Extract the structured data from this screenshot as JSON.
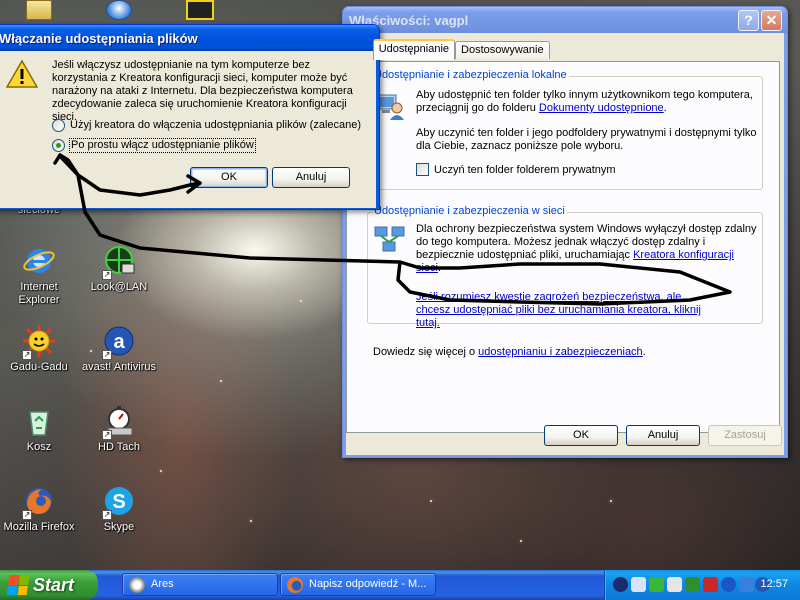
{
  "desktop": {
    "icons": [
      {
        "label": "sieciowe"
      },
      {
        "label": "Internet\nExplorer"
      },
      {
        "label": "Look@LAN"
      },
      {
        "label": "Gadu-Gadu"
      },
      {
        "label": "avast! Antivirus"
      },
      {
        "label": "Kosz"
      },
      {
        "label": "HD Tach"
      },
      {
        "label": "Mozilla Firefox"
      },
      {
        "label": "Skype"
      }
    ]
  },
  "warning_dialog": {
    "title": "Włączanie udostępniania plików",
    "message": "Jeśli włączysz udostępnianie na tym komputerze bez korzystania z Kreatora konfiguracji sieci, komputer może być narażony na ataki z Internetu. Dla bezpieczeństwa komputera zdecydowanie zaleca się uruchomienie Kreatora konfiguracji sieci.",
    "options": [
      {
        "label": "Użyj kreatora do włączenia udostępniania plików (zalecane)",
        "selected": false
      },
      {
        "label": "Po prostu włącz udostępnianie plików",
        "selected": true
      }
    ],
    "ok_label": "OK",
    "cancel_label": "Anuluj"
  },
  "properties_dialog": {
    "title": "Właściwości: vagpl",
    "help_label": "?",
    "close_label": "✕",
    "tabs": [
      {
        "label": "lne",
        "active": false
      },
      {
        "label": "Udostępnianie",
        "active": true
      },
      {
        "label": "Dostosowywanie",
        "active": false
      }
    ],
    "local": {
      "title": "Udostępnianie i zabezpieczenia lokalne",
      "text1": "Aby udostępnić ten folder tylko innym użytkownikom tego komputera, przeciągnij go do folderu",
      "text1_link": "Dokumenty udostępnione",
      "text2": "Aby uczynić ten folder i jego podfoldery prywatnymi i dostępnymi tylko dla Ciebie, zaznacz poniższe pole wyboru.",
      "checkbox_label": "Uczyń ten folder folderem prywatnym"
    },
    "network": {
      "title": "Udostępnianie i zabezpieczenia w sieci",
      "text": "Dla ochrony bezpieczeństwa system Windows wyłączył dostęp zdalny do tego komputera. Możesz jednak włączyć dostęp zdalny i bezpiecznie udostępniać pliki, uruchamiając",
      "text_link": "Kreatora konfiguracji sieci",
      "risk_link": "Jeśli rozumiesz kwestie zagrożeń bezpieczeństwa, ale chcesz udostępniać pliki bez uruchamiania kreatora, kliknij tutaj."
    },
    "more_info_prefix": "Dowiedz się więcej o",
    "more_info_link": "udostępnianiu i zabezpieczeniach",
    "ok_label": "OK",
    "cancel_label": "Anuluj",
    "apply_label": "Zastosuj"
  },
  "taskbar": {
    "start_label": "Start",
    "buttons": [
      {
        "label": "Ares"
      },
      {
        "label": "Napisz odpowiedź - M..."
      }
    ],
    "clock": "12:57"
  },
  "colors": {
    "xp_blue": "#0a5be0",
    "start_green": "#3a9e3a",
    "dialog_face": "#ece9d8",
    "link": "#0000cc",
    "group_title": "#0046d5",
    "annotation_ink": "#000000"
  }
}
